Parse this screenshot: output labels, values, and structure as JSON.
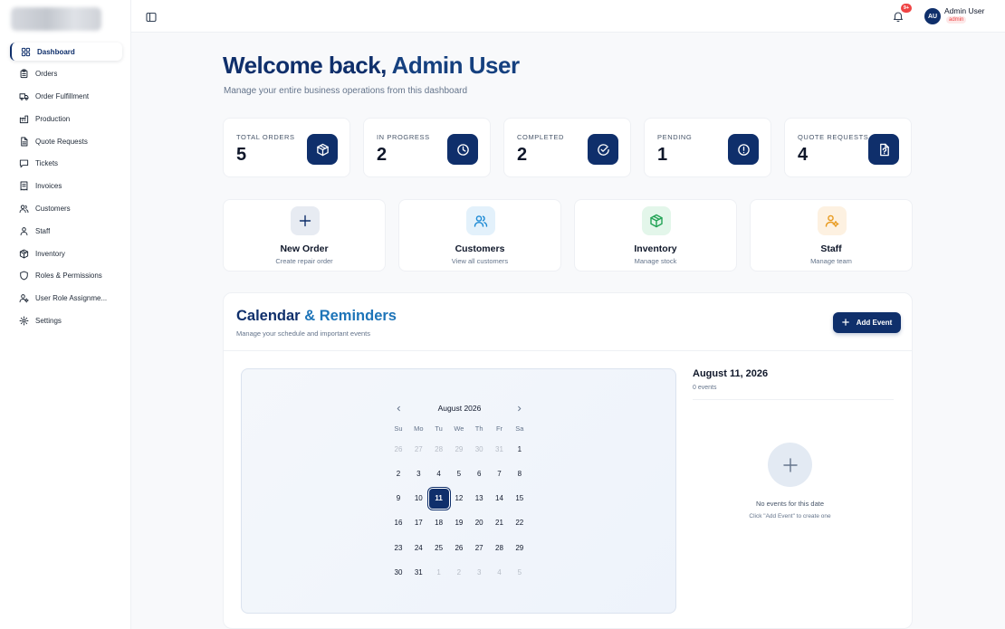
{
  "sidebar": {
    "items": [
      {
        "label": "Dashboard",
        "icon": "layout-grid-icon"
      },
      {
        "label": "Orders",
        "icon": "clipboard-icon"
      },
      {
        "label": "Order Fulfillment",
        "icon": "truck-icon"
      },
      {
        "label": "Production",
        "icon": "factory-icon"
      },
      {
        "label": "Quote Requests",
        "icon": "file-text-icon"
      },
      {
        "label": "Tickets",
        "icon": "message-square-icon"
      },
      {
        "label": "Invoices",
        "icon": "receipt-icon"
      },
      {
        "label": "Customers",
        "icon": "users-icon"
      },
      {
        "label": "Staff",
        "icon": "user-group-icon"
      },
      {
        "label": "Inventory",
        "icon": "package-icon"
      },
      {
        "label": "Roles & Permissions",
        "icon": "shield-icon"
      },
      {
        "label": "User Role Assignme...",
        "icon": "user-cog-icon"
      },
      {
        "label": "Settings",
        "icon": "gear-icon"
      }
    ],
    "active_index": 0
  },
  "topbar": {
    "notification_badge": "9+",
    "avatar_initials": "AU",
    "user_name": "Admin User",
    "user_role": "admin"
  },
  "header": {
    "welcome_prefix": "Welcome back, ",
    "welcome_name": "Admin User",
    "subtitle": "Manage your entire business operations from this dashboard"
  },
  "stats": [
    {
      "label": "TOTAL ORDERS",
      "value": "5",
      "icon": "package-icon"
    },
    {
      "label": "IN PROGRESS",
      "value": "2",
      "icon": "clock-icon"
    },
    {
      "label": "COMPLETED",
      "value": "2",
      "icon": "check-circle-icon"
    },
    {
      "label": "PENDING",
      "value": "1",
      "icon": "alert-circle-icon"
    },
    {
      "label": "QUOTE REQUESTS",
      "value": "4",
      "icon": "file-question-icon"
    }
  ],
  "quick_actions": [
    {
      "title": "New Order",
      "subtitle": "Create repair order",
      "icon": "plus-icon"
    },
    {
      "title": "Customers",
      "subtitle": "View all customers",
      "icon": "users-icon"
    },
    {
      "title": "Inventory",
      "subtitle": "Manage stock",
      "icon": "package-icon"
    },
    {
      "title": "Staff",
      "subtitle": "Manage team",
      "icon": "user-cog-icon"
    }
  ],
  "calendar": {
    "title_main": "Calendar ",
    "title_accent": "& Reminders",
    "subtitle": "Manage your schedule and important events",
    "add_event_label": "Add Event",
    "month_label": "August 2026",
    "weekdays": [
      "Su",
      "Mo",
      "Tu",
      "We",
      "Th",
      "Fr",
      "Sa"
    ],
    "weeks": [
      [
        "26",
        "27",
        "28",
        "29",
        "30",
        "31",
        "1"
      ],
      [
        "2",
        "3",
        "4",
        "5",
        "6",
        "7",
        "8"
      ],
      [
        "9",
        "10",
        "11",
        "12",
        "13",
        "14",
        "15"
      ],
      [
        "16",
        "17",
        "18",
        "19",
        "20",
        "21",
        "22"
      ],
      [
        "23",
        "24",
        "25",
        "26",
        "27",
        "28",
        "29"
      ],
      [
        "30",
        "31",
        "1",
        "2",
        "3",
        "4",
        "5"
      ]
    ],
    "selected_day": "11",
    "selected_date_label": "August 11, 2026",
    "event_count_label": "0 events",
    "empty_title": "No events for this date",
    "empty_subtitle": "Click \"Add Event\" to create one"
  },
  "colors": {
    "brand": "#0f2f6b",
    "accent": "#1d74b8",
    "badge": "#ef4444"
  }
}
